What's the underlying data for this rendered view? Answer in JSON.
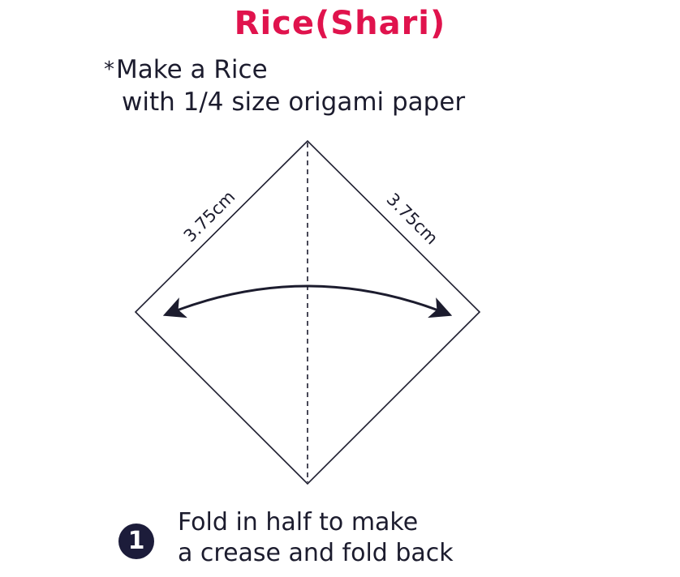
{
  "title": "Rice(Shari)",
  "note": {
    "marker": "*",
    "line1": "Make a Rice",
    "line2": "with 1/4 size origami paper"
  },
  "diagram": {
    "left_edge_label": "3.75cm",
    "right_edge_label": "3.75cm",
    "stroke_color": "#1c1c2e"
  },
  "step": {
    "number": "1",
    "line1": "Fold in half to make",
    "line2": "a crease and fold back"
  },
  "colors": {
    "title": "#e0134d",
    "text": "#1c1c2e",
    "badge": "#1c1c3a"
  }
}
